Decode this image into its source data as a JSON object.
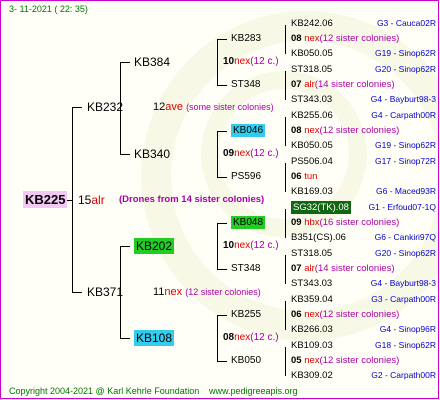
{
  "header": {
    "date": "3- 11-2021 ( 22: 35)"
  },
  "root": {
    "id": "KB225",
    "num": "15",
    "code": "alr",
    "note": "(Drones from 14 sister colonies)"
  },
  "g2": [
    {
      "id": "KB232",
      "num": "12",
      "code": "ave",
      "note": "(some sister colonies)"
    },
    {
      "id": "KB371",
      "num": "11",
      "code": "nex",
      "note": "(12 sister colonies)"
    }
  ],
  "g3": [
    {
      "id": "KB384",
      "num": "10",
      "code": "nex",
      "note": "(12 c.)"
    },
    {
      "id": "KB340",
      "num": "09",
      "code": "nex",
      "note": "(12 c.)"
    },
    {
      "id": "KB202",
      "num": "10",
      "code": "nex",
      "note": "(12 c.)"
    },
    {
      "id": "KB108",
      "num": "08",
      "code": "nex",
      "note": "(12 c.)"
    }
  ],
  "g4": [
    {
      "id": "KB283"
    },
    {
      "id": "ST348"
    },
    {
      "id": "KB046"
    },
    {
      "id": "PS596"
    },
    {
      "id": "KB048"
    },
    {
      "id": "ST348"
    },
    {
      "id": "KB255"
    },
    {
      "id": "KB050"
    }
  ],
  "g5": [
    {
      "id": "KB242.06",
      "loc": "G3 - Cauca02R"
    },
    {
      "num": "08",
      "code": "nex",
      "note": "(12 sister colonies)"
    },
    {
      "id": "KB050.05",
      "loc": "G19 - Sinop62R"
    },
    {
      "id": "ST318.05",
      "loc": "G20 - Sinop62R"
    },
    {
      "num": "07",
      "code": "alr",
      "note": "(14 sister colonies)"
    },
    {
      "id": "ST343.03",
      "loc": "G4 - Bayburt98-3"
    },
    {
      "id": "KB255.06",
      "loc": "G4 - Carpath00R"
    },
    {
      "num": "08",
      "code": "nex",
      "note": "(12 sister colonies)"
    },
    {
      "id": "KB050.05",
      "loc": "G19 - Sinop62R"
    },
    {
      "id": "PS506.04",
      "loc": "G17 - Sinop72R"
    },
    {
      "num": "06",
      "code": "tun",
      "note": ""
    },
    {
      "id": "KB169.03",
      "loc": "G6 - Maced93R"
    },
    {
      "id": "SG32(TK).08",
      "loc": "G1 - Erfoud07-1Q",
      "hl": "dark"
    },
    {
      "num": "09",
      "code": "hbx",
      "note": "(16 sister colonies)"
    },
    {
      "id": "B351(CS).06",
      "loc": "G6 - Cankiri97Q"
    },
    {
      "id": "ST318.05",
      "loc": "G20 - Sinop62R"
    },
    {
      "num": "07",
      "code": "alr",
      "note": "(14 sister colonies)"
    },
    {
      "id": "ST343.03",
      "loc": "G4 - Bayburt98-3"
    },
    {
      "id": "KB359.04",
      "loc": "G3 - Carpath00R"
    },
    {
      "num": "06",
      "code": "nex",
      "note": "(12 sister colonies)"
    },
    {
      "id": "KB266.03",
      "loc": "G4 - Sinop96R"
    },
    {
      "id": "KB109.03",
      "loc": "G18 - Sinop62R"
    },
    {
      "num": "05",
      "code": "nex",
      "note": "(12 sister colonies)"
    },
    {
      "id": "KB309.02",
      "loc": "G2 - Carpath00R"
    }
  ],
  "footer": {
    "copyright": "Copyright 2004-2021 @ Karl Kehrle Foundation",
    "site": "www.pedigreeapis.org"
  }
}
